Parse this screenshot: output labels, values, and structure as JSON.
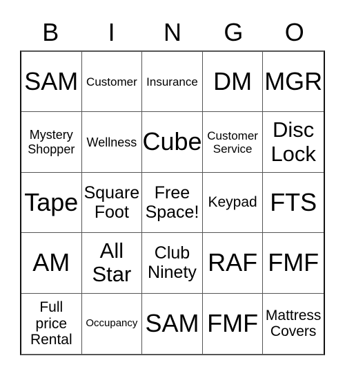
{
  "header": {
    "letters": [
      "B",
      "I",
      "N",
      "G",
      "O"
    ]
  },
  "cells": [
    {
      "text": "SAM",
      "size": "xl"
    },
    {
      "text": "Customer",
      "size": "xs"
    },
    {
      "text": "Insurance",
      "size": "xs"
    },
    {
      "text": "DM",
      "size": "xl"
    },
    {
      "text": "MGR",
      "size": "xl"
    },
    {
      "text": "Mystery\nShopper",
      "size": "s"
    },
    {
      "text": "Wellness",
      "size": "s"
    },
    {
      "text": "Cube",
      "size": "xl"
    },
    {
      "text": "Customer\nService",
      "size": "xs"
    },
    {
      "text": "Disc\nLock",
      "size": "l"
    },
    {
      "text": "Tape",
      "size": "xl"
    },
    {
      "text": "Square\nFoot",
      "size": "ml"
    },
    {
      "text": "Free\nSpace!",
      "size": "ml"
    },
    {
      "text": "Keypad",
      "size": "sm"
    },
    {
      "text": "FTS",
      "size": "xl"
    },
    {
      "text": "AM",
      "size": "xl"
    },
    {
      "text": "All\nStar",
      "size": "l"
    },
    {
      "text": "Club\nNinety",
      "size": "ml"
    },
    {
      "text": "RAF",
      "size": "xl"
    },
    {
      "text": "FMF",
      "size": "xl"
    },
    {
      "text": "Full\nprice\nRental",
      "size": "sm"
    },
    {
      "text": "Occupancy",
      "size": "xxs"
    },
    {
      "text": "SAM",
      "size": "xl"
    },
    {
      "text": "FMF",
      "size": "xl"
    },
    {
      "text": "Mattress\nCovers",
      "size": "sm"
    }
  ]
}
